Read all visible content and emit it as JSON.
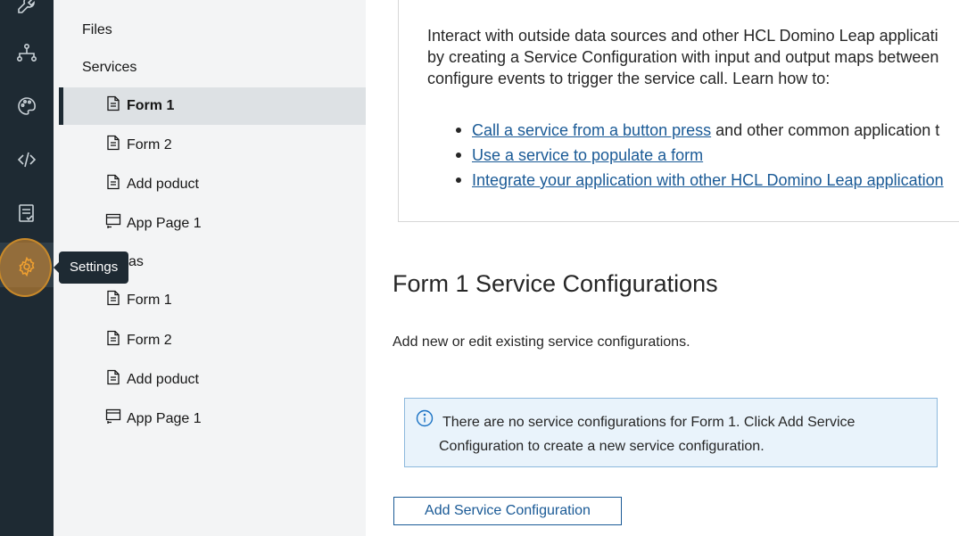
{
  "rail": {
    "items": [
      {
        "icon": "wrench-icon"
      },
      {
        "icon": "sitemap-icon"
      },
      {
        "icon": "palette-icon"
      },
      {
        "icon": "code-icon"
      },
      {
        "icon": "checklist-icon"
      },
      {
        "icon": "gear-icon",
        "active": true
      }
    ],
    "tooltip": "Settings"
  },
  "tree": {
    "headings": [
      "Files",
      "Services",
      "as"
    ],
    "services_items": [
      {
        "label": "Form 1",
        "icon": "form-icon",
        "selected": true
      },
      {
        "label": "Form 2",
        "icon": "form-icon"
      },
      {
        "label": "Add poduct",
        "icon": "form-icon"
      },
      {
        "label": "App Page 1",
        "icon": "app-page-icon"
      }
    ],
    "second_items": [
      {
        "label": "Form 1",
        "icon": "form-icon"
      },
      {
        "label": "Form 2",
        "icon": "form-icon"
      },
      {
        "label": "Add poduct",
        "icon": "form-icon"
      },
      {
        "label": "App Page 1",
        "icon": "app-page-icon"
      }
    ]
  },
  "intro": {
    "lines": [
      "Interact with outside data sources and other HCL Domino Leap applicati",
      "by creating a Service Configuration with input and output maps between",
      "configure events to trigger the service call. Learn how to:"
    ],
    "links": [
      {
        "link": "Call a service from a button press",
        "rest": " and other common application t"
      },
      {
        "link": "Use a service to populate a form",
        "rest": ""
      },
      {
        "link": "Integrate your application with other HCL Domino Leap application",
        "rest": ""
      }
    ]
  },
  "section": {
    "title": "Form 1 Service Configurations",
    "description": "Add new or edit existing service configurations.",
    "notice_line1": "There are no service configurations for Form 1. Click Add Service",
    "notice_line2": "Configuration to create a new service configuration.",
    "add_button": "Add Service Configuration"
  },
  "colors": {
    "rail_bg": "#1e2a33",
    "accent_link": "#1a5a96",
    "focus_ring": "#e6962d",
    "notice_bg": "#e9f3fb"
  }
}
